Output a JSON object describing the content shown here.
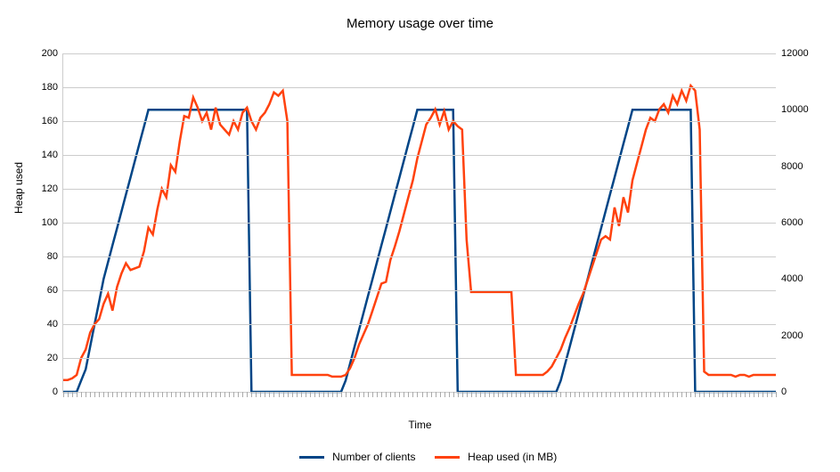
{
  "chart_data": {
    "type": "line",
    "title": "Memory usage over time",
    "xlabel": "Time",
    "ylabel": "Heap used",
    "ylim": [
      0,
      200
    ],
    "y2lim": [
      0,
      12000
    ],
    "yticks": [
      0,
      20,
      40,
      60,
      80,
      100,
      120,
      140,
      160,
      180,
      200
    ],
    "y2ticks": [
      0,
      2000,
      4000,
      6000,
      8000,
      10000,
      12000
    ],
    "x_count": 160,
    "colors": {
      "clients": "#004586",
      "heap": "#ff420e"
    },
    "legend": [
      {
        "name": "Number of clients",
        "color": "#004586",
        "axis": "y2"
      },
      {
        "name": "Heap used (in MB)",
        "color": "#ff420e",
        "axis": "y"
      }
    ],
    "series": [
      {
        "name": "Number of clients",
        "axis": "y2",
        "values": [
          0,
          0,
          0,
          0,
          400,
          800,
          1600,
          2400,
          3200,
          4000,
          4600,
          5200,
          5800,
          6400,
          7000,
          7600,
          8200,
          8800,
          9400,
          10000,
          10000,
          10000,
          10000,
          10000,
          10000,
          10000,
          10000,
          10000,
          10000,
          10000,
          10000,
          10000,
          10000,
          10000,
          10000,
          10000,
          10000,
          10000,
          10000,
          10000,
          10000,
          10000,
          0,
          0,
          0,
          0,
          0,
          0,
          0,
          0,
          0,
          0,
          0,
          0,
          0,
          0,
          0,
          0,
          0,
          0,
          0,
          0,
          0,
          400,
          1000,
          1600,
          2200,
          2800,
          3400,
          4000,
          4600,
          5200,
          5800,
          6400,
          7000,
          7600,
          8200,
          8800,
          9400,
          10000,
          10000,
          10000,
          10000,
          10000,
          10000,
          10000,
          10000,
          10000,
          0,
          0,
          0,
          0,
          0,
          0,
          0,
          0,
          0,
          0,
          0,
          0,
          0,
          0,
          0,
          0,
          0,
          0,
          0,
          0,
          0,
          0,
          0,
          400,
          1000,
          1600,
          2200,
          2800,
          3400,
          4000,
          4600,
          5200,
          5800,
          6400,
          7000,
          7600,
          8200,
          8800,
          9400,
          10000,
          10000,
          10000,
          10000,
          10000,
          10000,
          10000,
          10000,
          10000,
          10000,
          10000,
          10000,
          10000,
          10000,
          0,
          0,
          0,
          0,
          0,
          0,
          0,
          0,
          0,
          0,
          0,
          0,
          0,
          0,
          0,
          0,
          0,
          0,
          0
        ]
      },
      {
        "name": "Heap used (in MB)",
        "axis": "y",
        "values": [
          7,
          7,
          8,
          10,
          20,
          25,
          35,
          40,
          43,
          52,
          58,
          48,
          62,
          70,
          76,
          72,
          73,
          74,
          83,
          97,
          93,
          108,
          120,
          115,
          134,
          130,
          148,
          163,
          162,
          174,
          168,
          160,
          165,
          155,
          168,
          158,
          155,
          152,
          160,
          155,
          165,
          168,
          160,
          155,
          162,
          165,
          170,
          177,
          175,
          178,
          160,
          10,
          10,
          10,
          10,
          10,
          10,
          10,
          10,
          10,
          9,
          9,
          9,
          10,
          14,
          20,
          28,
          34,
          40,
          48,
          56,
          64,
          65,
          78,
          86,
          95,
          105,
          115,
          125,
          138,
          148,
          158,
          162,
          167,
          158,
          166,
          155,
          160,
          157,
          155,
          90,
          59,
          59,
          59,
          59,
          59,
          59,
          59,
          59,
          59,
          59,
          10,
          10,
          10,
          10,
          10,
          10,
          10,
          12,
          15,
          20,
          25,
          32,
          38,
          45,
          52,
          58,
          66,
          74,
          82,
          90,
          92,
          90,
          109,
          98,
          115,
          106,
          125,
          135,
          145,
          155,
          162,
          160,
          167,
          170,
          165,
          175,
          170,
          178,
          172,
          181,
          178,
          155,
          12,
          10,
          10,
          10,
          10,
          10,
          10,
          9,
          10,
          10,
          9,
          10,
          10,
          10,
          10,
          10,
          10
        ]
      }
    ]
  }
}
